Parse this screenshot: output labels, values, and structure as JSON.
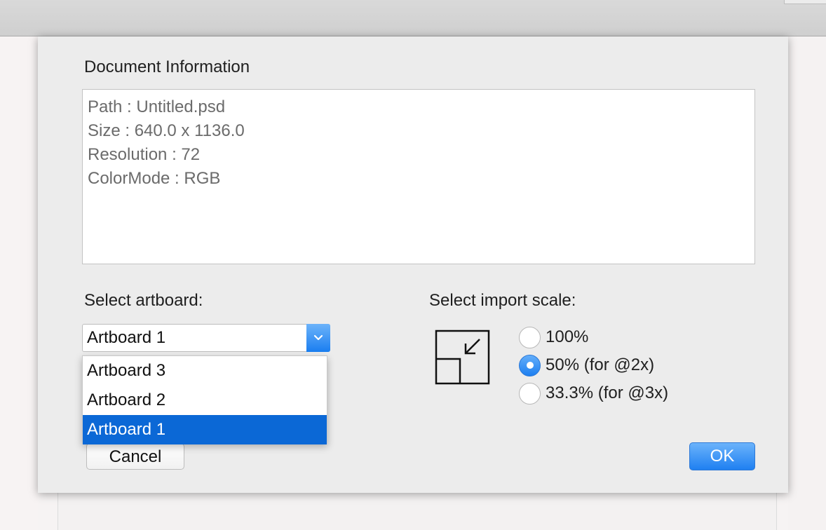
{
  "dialog": {
    "section_title": "Document Information",
    "info_lines": [
      "Path : Untitled.psd",
      "Size : 640.0 x 1136.0",
      "Resolution : 72",
      "ColorMode : RGB"
    ],
    "artboard_label": "Select artboard:",
    "artboard_selected": "Artboard 1",
    "artboard_options": [
      "Artboard 3",
      "Artboard 2",
      "Artboard 1"
    ],
    "scale_label": "Select import scale:",
    "scale_options": [
      "100%",
      "50% (for @2x)",
      "33.3% (for @3x)"
    ],
    "scale_selected": "50% (for @2x)",
    "cancel_label": "Cancel",
    "ok_label": "OK"
  },
  "colors": {
    "accent": "#1a7ef0",
    "highlight": "#0b68d6"
  },
  "icons": {
    "scale_icon": "scale-down-icon",
    "select_arrow": "chevron-down-icon"
  }
}
